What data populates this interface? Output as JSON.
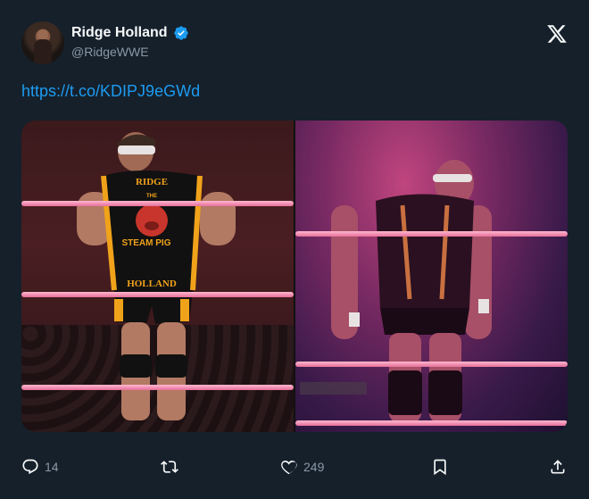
{
  "author": {
    "name": "Ridge Holland",
    "handle": "@RidgeWWE",
    "verified": true
  },
  "tweet": {
    "link_text": "https://t.co/KDIPJ9eGWd"
  },
  "media": {
    "left_image_text": {
      "top": "RIDGE",
      "the": "THE",
      "middle": "STEAM PIG",
      "bottom": "HOLLAND"
    }
  },
  "actions": {
    "reply_count": "14",
    "like_count": "249"
  },
  "icons": {
    "logo": "x-logo-icon",
    "verified": "verified-badge-icon",
    "reply": "reply-icon",
    "retweet": "retweet-icon",
    "like": "heart-icon",
    "bookmark": "bookmark-icon",
    "share": "share-icon"
  },
  "colors": {
    "background": "#15202b",
    "link": "#1d9bf0",
    "verified": "#1d9bf0",
    "secondary_text": "#8b98a5"
  }
}
